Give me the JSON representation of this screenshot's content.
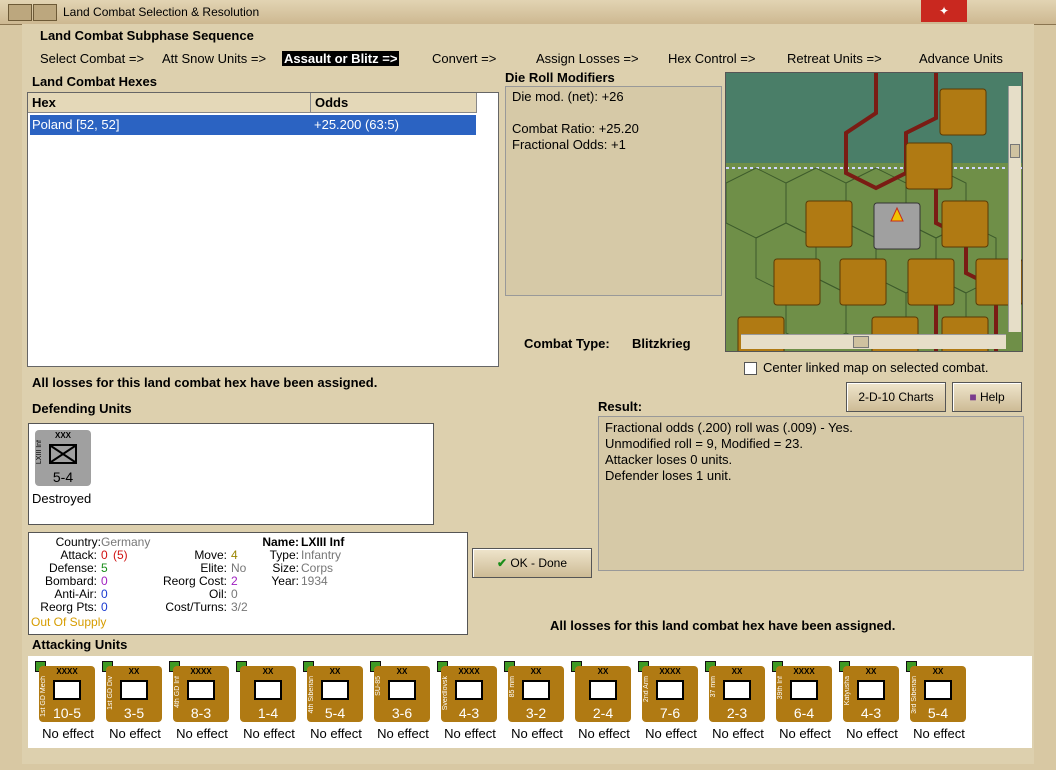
{
  "window": {
    "title": "Land Combat Selection & Resolution"
  },
  "subphase": {
    "title": "Land Combat Subphase Sequence",
    "steps": [
      "Select Combat =>",
      "Att Snow Units =>",
      "Assault or Blitz =>",
      "Convert =>",
      "Assign Losses =>",
      "Hex Control =>",
      "Retreat Units =>",
      "Advance Units"
    ]
  },
  "hexes": {
    "title": "Land Combat Hexes",
    "col_hex": "Hex",
    "col_odds": "Odds",
    "rows": [
      {
        "hex": "Poland [52, 52]",
        "odds": "+25.200 (63:5)"
      }
    ]
  },
  "modifiers": {
    "title": "Die Roll Modifiers",
    "net": "Die mod. (net): +26",
    "ratio": "Combat Ratio: +25.20",
    "fraction": "Fractional Odds: +1"
  },
  "combat_type": {
    "label": "Combat Type:",
    "value": "Blitzkrieg"
  },
  "center_map": "Center linked map on selected combat.",
  "losses_msg": "All losses for this land combat hex have been assigned.",
  "buttons": {
    "charts": "2-D-10 Charts",
    "help": "Help",
    "ok": "OK - Done"
  },
  "defending": {
    "title": "Defending Units",
    "unit": {
      "name": "LXIII Inf",
      "size": "XXX",
      "strength": "5-4",
      "status": "Destroyed",
      "color": "#a0a0a0"
    }
  },
  "info": {
    "country_label": "Country:",
    "country": "Germany",
    "attack_label": "Attack:",
    "attack": "0",
    "attack_extra": "(5)",
    "defense_label": "Defense:",
    "defense": "5",
    "bombard_label": "Bombard:",
    "bombard": "0",
    "aa_label": "Anti-Air:",
    "aa": "0",
    "reorg_label": "Reorg Pts:",
    "reorg": "0",
    "supply": "Out Of Supply",
    "move_label": "Move:",
    "move": "4",
    "elite_label": "Elite:",
    "elite": "No",
    "reorg_cost_label": "Reorg Cost:",
    "reorg_cost": "2",
    "oil_label": "Oil:",
    "oil": "0",
    "cost_label": "Cost/Turns:",
    "cost": "3/2",
    "name_label": "Name:",
    "name": "LXIII Inf",
    "type_label": "Type:",
    "type": "Infantry",
    "size_label": "Size:",
    "size": "Corps",
    "year_label": "Year:",
    "year": "1934"
  },
  "result": {
    "title": "Result:",
    "lines": [
      "Fractional odds (.200) roll was (.009)  - Yes.",
      "Unmodified roll = 9, Modified = 23.",
      "Attacker loses 0 units.",
      "Defender loses 1 unit."
    ]
  },
  "attacking": {
    "title": "Attacking Units",
    "units": [
      {
        "name": "1st GD Mech",
        "size": "XXXX",
        "strength": "10-5",
        "result": "No effect"
      },
      {
        "name": "1st GD Div",
        "size": "XX",
        "strength": "3-5",
        "result": "No effect"
      },
      {
        "name": "4th GD Inf",
        "size": "XXXX",
        "strength": "8-3",
        "result": "No effect"
      },
      {
        "name": "",
        "size": "XX",
        "strength": "1-4",
        "result": "No effect"
      },
      {
        "name": "4th Siberian",
        "size": "XX",
        "strength": "5-4",
        "result": "No effect"
      },
      {
        "name": "SU-85",
        "size": "XX",
        "strength": "3-6",
        "result": "No effect"
      },
      {
        "name": "Sverdlovsk",
        "size": "XXXX",
        "strength": "4-3",
        "result": "No effect"
      },
      {
        "name": "85 mm",
        "size": "XX",
        "strength": "3-2",
        "result": "No effect"
      },
      {
        "name": "",
        "size": "XX",
        "strength": "2-4",
        "result": "No effect"
      },
      {
        "name": "2nd Arm",
        "size": "XXXX",
        "strength": "7-6",
        "result": "No effect"
      },
      {
        "name": "37 mm",
        "size": "XX",
        "strength": "2-3",
        "result": "No effect"
      },
      {
        "name": "39th Inf",
        "size": "XXXX",
        "strength": "6-4",
        "result": "No effect"
      },
      {
        "name": "Katyusha",
        "size": "XX",
        "strength": "4-3",
        "result": "No effect"
      },
      {
        "name": "3rd Siberian",
        "size": "XX",
        "strength": "5-4",
        "result": "No effect"
      }
    ]
  },
  "colors": {
    "counter": "#b07a13",
    "selection": "#2b63c2",
    "panel_bg": "#ddd0ae"
  }
}
